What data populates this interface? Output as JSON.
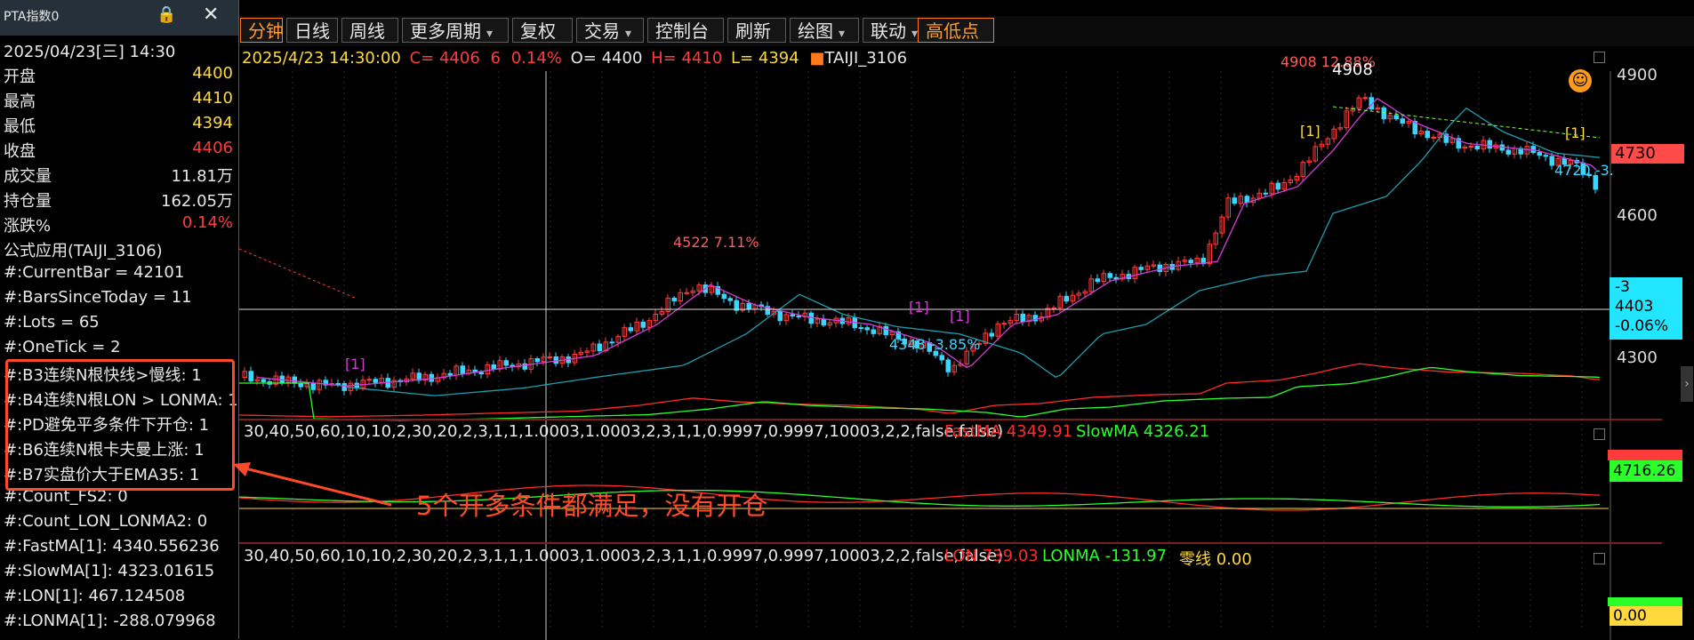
{
  "panel": {
    "title": "PTA指数0",
    "datetime": "2025/04/23[三] 14:30",
    "rows": [
      {
        "label": "开盘",
        "value": "4400",
        "color": "#ffd93b"
      },
      {
        "label": "最高",
        "value": "4410",
        "color": "#ffd93b"
      },
      {
        "label": "最低",
        "value": "4394",
        "color": "#ffd93b"
      },
      {
        "label": "收盘",
        "value": "4406",
        "color": "#ff3b3b"
      },
      {
        "label": "成交量",
        "value": "11.81万",
        "color": "#e8e8e8"
      },
      {
        "label": "持仓量",
        "value": "162.05万",
        "color": "#e8e8e8"
      },
      {
        "label": "涨跌%",
        "value": "0.14%",
        "color": "#ff3b3b"
      }
    ],
    "formula_title": "公式应用(TAIJI_3106)",
    "formula_lines": [
      "#:CurrentBar = 42101",
      "#:BarsSinceToday = 11",
      "#:Lots = 65",
      "#:OneTick = 2",
      "#:B3连续N根快线>慢线: 1",
      "#:B4连续N根LON > LONMA: 1",
      "#:PD避免平多条件下开仓: 1",
      "#:B6连续N根卡夫曼上涨: 1",
      "#:B7实盘价大于EMA35: 1",
      "#:Count_FS2: 0",
      "#:Count_LON_LONMA2: 0",
      "#:FastMA[1]: 4340.556236",
      "#:SlowMA[1]: 4323.01615",
      "#:LON[1]: 467.124508",
      "#:LONMA[1]: -288.079968"
    ]
  },
  "toolbar": {
    "items": [
      {
        "label": "分钟",
        "active": true,
        "dropdown": false
      },
      {
        "label": "日线",
        "active": false,
        "dropdown": false
      },
      {
        "label": "周线",
        "active": false,
        "dropdown": false
      },
      {
        "label": "更多周期",
        "active": false,
        "dropdown": true
      },
      {
        "label": "复权",
        "active": false,
        "dropdown": false
      },
      {
        "label": "交易",
        "active": false,
        "dropdown": true
      },
      {
        "label": "控制台",
        "active": false,
        "dropdown": false
      },
      {
        "label": "刷新",
        "active": false,
        "dropdown": false
      },
      {
        "label": "绘图",
        "active": false,
        "dropdown": true
      },
      {
        "label": "联动",
        "active": false,
        "dropdown": true
      },
      {
        "label": "高低点",
        "active": true,
        "dropdown": false
      }
    ]
  },
  "header": {
    "date": "2025/4/23 14:30:00",
    "c": "C= 4406",
    "chg": "6",
    "pct": "0.14%",
    "o": "O= 4400",
    "h": "H= 4410",
    "l": "L= 4394",
    "formula": "TAIJI_3106"
  },
  "price_axis": {
    "ticks": [
      "4900",
      "4600",
      "4300"
    ],
    "last_price": "4730",
    "cursor_box": [
      "-3",
      "4403",
      "-0.06%"
    ]
  },
  "annotations": {
    "high_label": "4908 12.88%",
    "high_value": "4908",
    "mid_label": "4522 7.11%",
    "low_label": "4348 -3.85%",
    "end_label": "4720 -3.",
    "signal": "[1]"
  },
  "callout": {
    "text": "5个开多条件都满足，没有开仓",
    "color": "#ff4a2a"
  },
  "pane1": {
    "params": "30,40,50,60,10,10,2,30,20,2,3,1,1,1.0003,1.0003,2,3,1,1,0.9997,0.9997,10003,2,2,false,false)",
    "fast": "FastMA 4349.91",
    "slow": "SlowMA 4326.21",
    "value_box": "4716.26"
  },
  "pane2": {
    "params": "30,40,50,60,10,10,2,30,20,2,3,1,1,1.0003,1.0003,2,3,1,1,0.9997,0.9997,10003,2,2,false,false)",
    "lon": "LON 739.03",
    "lonma": "LONMA -131.97",
    "zero": "零线 0.00",
    "value_box": "0.00"
  },
  "colors": {
    "up": "#ff3b3b",
    "down": "#3bd5ff",
    "ma_magenta": "#d63bd6",
    "ma_teal": "#1f9db0",
    "fast": "#ff2a2a",
    "slow": "#2aff2a"
  }
}
